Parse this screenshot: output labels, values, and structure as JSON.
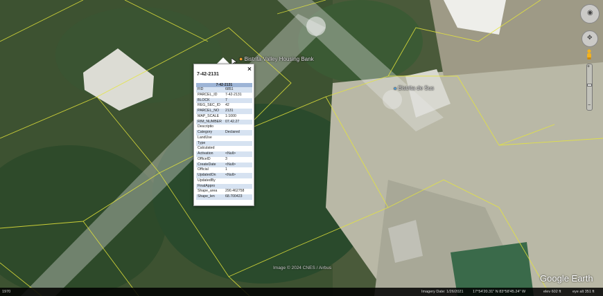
{
  "map": {
    "placemarks": [
      {
        "name": "Bistrita Valley Housing Bank",
        "color": "#f0a030"
      },
      {
        "name": "Bistrita de Sus",
        "color": "#4a9ee0"
      }
    ],
    "parcel_line_color": "#e6e63a",
    "copyright": "Image © 2024 CNES / Airbus"
  },
  "popup": {
    "title": "7-42-2131",
    "close_icon": "×",
    "table_header": "7-42-2131",
    "rows": [
      {
        "key": "FID",
        "value": "6851"
      },
      {
        "key": "PARCEL_ID",
        "value": "7-42-2131"
      },
      {
        "key": "BLOCK",
        "value": "7"
      },
      {
        "key": "REG_SEC_ID",
        "value": "42"
      },
      {
        "key": "PARCEL_NO",
        "value": "2131"
      },
      {
        "key": "MAP_SCALE",
        "value": "1:1000"
      },
      {
        "key": "RIM_NUMBER",
        "value": "07.42.27"
      },
      {
        "key": "Descriptio",
        "value": ""
      },
      {
        "key": "Category",
        "value": "Declared"
      },
      {
        "key": "LandUse",
        "value": ""
      },
      {
        "key": "Type",
        "value": ""
      },
      {
        "key": "Calculated",
        "value": ""
      },
      {
        "key": "Activation",
        "value": "<Null>"
      },
      {
        "key": "OfficeID",
        "value": "3"
      },
      {
        "key": "CreateDate",
        "value": "<Null>"
      },
      {
        "key": "Official",
        "value": "1"
      },
      {
        "key": "UpdatedOn",
        "value": "<Null>"
      },
      {
        "key": "UpdatedBy",
        "value": ""
      },
      {
        "key": "FinalAppro",
        "value": ""
      },
      {
        "key": "Shape_area",
        "value": "290.462758"
      },
      {
        "key": "Shape_len",
        "value": "68.700423"
      }
    ]
  },
  "status": {
    "left": "1970",
    "imagery_date": "Imagery Date: 1/26/2021",
    "coords": "17°54'20.31\" N  83°58'45.24\" W",
    "elev": "elev 602 ft",
    "eye": "eye alt 351 ft"
  },
  "brand": "Google Earth"
}
